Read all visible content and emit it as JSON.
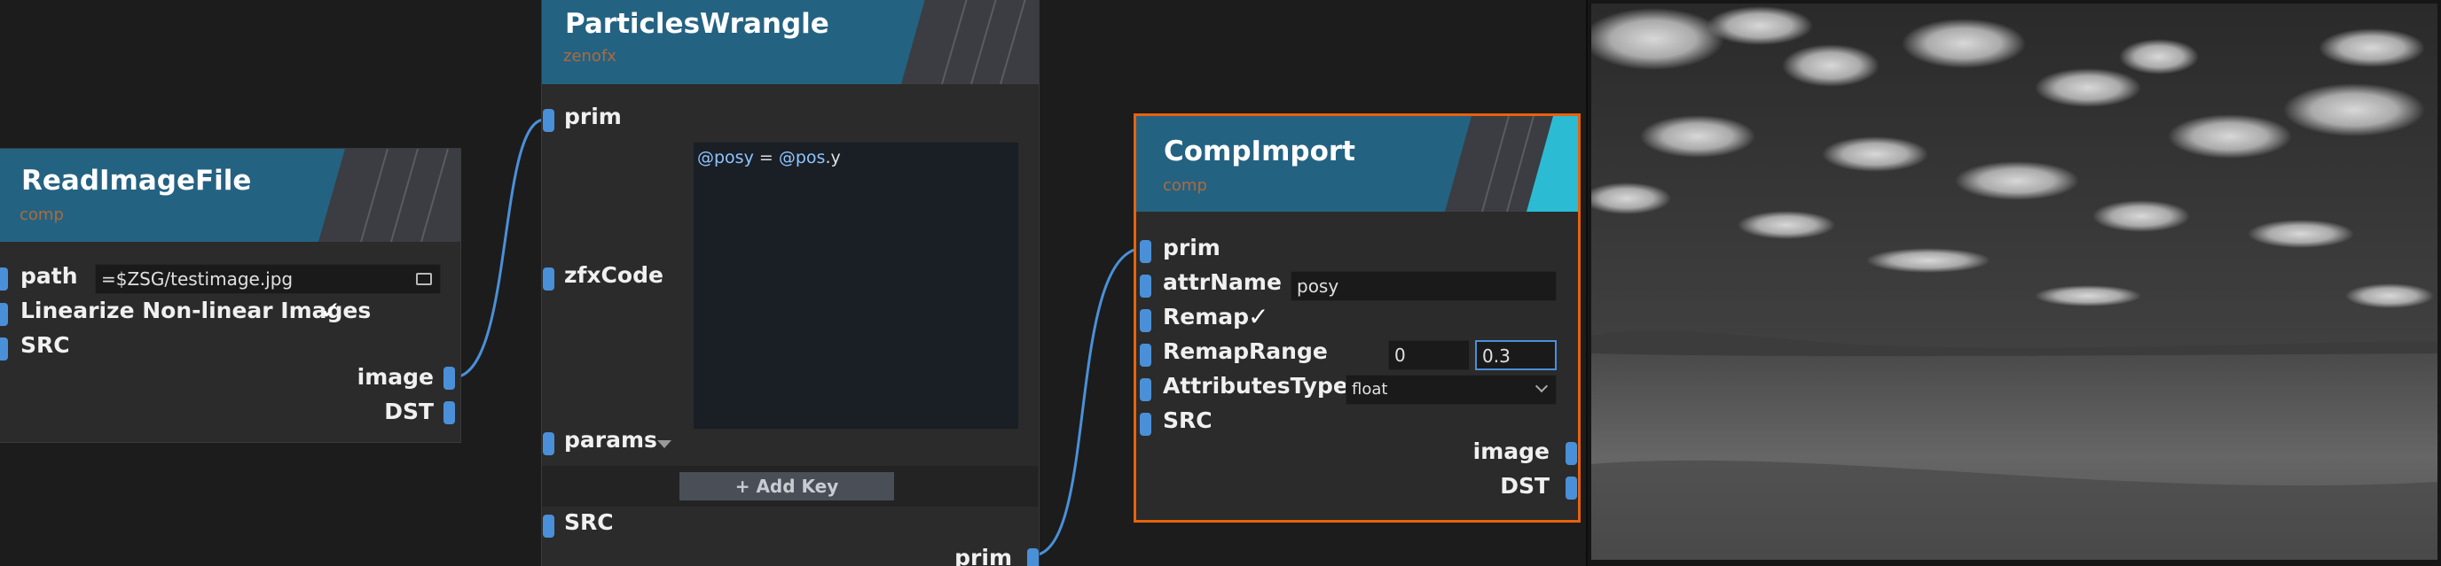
{
  "colors": {
    "background": "#1c1c1c",
    "node_body": "#2b2b2b",
    "node_header": "#246282",
    "header_deco": "#3b3d43",
    "socket": "#4a90d9",
    "wire": "#4a90d9",
    "subtitle": "#b06a3a",
    "selected_border": "#e8620c",
    "active_accent": "#2bbcd4"
  },
  "nodes": {
    "readimagefile": {
      "title": "ReadImageFile",
      "category": "comp",
      "inputs": {
        "path": "path",
        "path_value": "=$ZSG/testimage.jpg",
        "linearize": "Linearize Non-linear Images",
        "linearize_checked": "✓",
        "src": "SRC"
      },
      "outputs": {
        "image": "image",
        "dst": "DST"
      },
      "icons": {
        "folder": "folder-icon"
      }
    },
    "particleswrangle": {
      "title": "ParticlesWrangle",
      "category": "zenofx",
      "inputs": {
        "prim": "prim",
        "zfxcode": "zfxCode",
        "params": "params",
        "src": "SRC"
      },
      "code": {
        "var1": "@posy",
        "op": "=",
        "var2": "@pos",
        "suffix": ".y"
      },
      "add_key_label": "+ Add Key",
      "outputs": {
        "prim": "prim"
      }
    },
    "compimport": {
      "title": "CompImport",
      "category": "comp",
      "inputs": {
        "prim": "prim",
        "attrname": "attrName",
        "attrname_value": "posy",
        "remap": "Remap",
        "remap_checked": "✓",
        "remaprange": "RemapRange",
        "remaprange_min": "0",
        "remaprange_max": "0.3",
        "attributestype": "AttributesType",
        "attributestype_value": "float",
        "src": "SRC"
      },
      "outputs": {
        "image": "image",
        "dst": "DST"
      }
    }
  },
  "preview": {
    "description_icon": "landscape-preview-image"
  }
}
